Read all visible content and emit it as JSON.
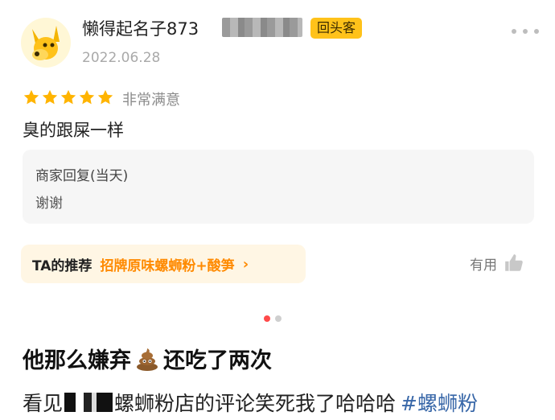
{
  "review": {
    "username": "懒得起名子873",
    "badge": "回头客",
    "date": "2022.06.28",
    "rating": 5,
    "rating_max": 5,
    "rating_text": "非常满意",
    "text": "臭的跟屎一样"
  },
  "reply": {
    "title": "商家回复(当天)",
    "text": "谢谢"
  },
  "recommend": {
    "label": "TA的推荐",
    "item": "招牌原味螺蛳粉+酸笋",
    "arrow": "›"
  },
  "helpful": {
    "label": "有用"
  },
  "pager": {
    "count": 2,
    "active": 0
  },
  "post": {
    "title_before": "他那么嫌弃",
    "title_after": "还吃了两次",
    "body_prefix": "看见",
    "body_main": "螺蛳粉店的评论笑死我了哈哈哈",
    "hashtag": "#螺蛳粉"
  },
  "colors": {
    "badge_bg": "#ffc21a",
    "star": "#ffb400",
    "recommend_bg": "#fff6e4",
    "recommend_accent": "#ff8a00",
    "hashtag": "#3867a8",
    "active_dot": "#ff4a4a"
  },
  "icons": {
    "avatar": "yellow-dog-avatar",
    "more": "more-dots-icon",
    "star": "star-icon",
    "thumb": "thumb-up-icon",
    "poop": "poop-emoji-icon"
  }
}
